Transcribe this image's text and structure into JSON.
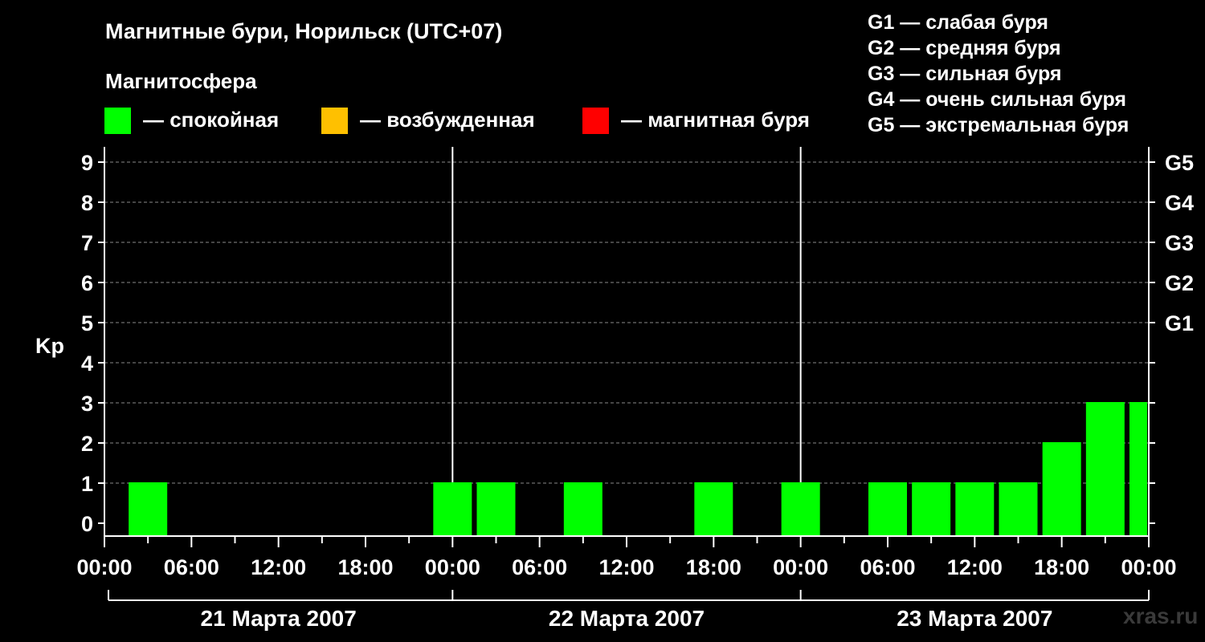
{
  "title": "Магнитные бури, Норильск (UTC+07)",
  "legend": {
    "title": "Магнитосфера",
    "items": [
      {
        "label": "— спокойная",
        "color": "#00ff00"
      },
      {
        "label": "— возбужденная",
        "color": "#ffc000"
      },
      {
        "label": "— магнитная буря",
        "color": "#ff0000"
      }
    ]
  },
  "g_scale_legend": [
    "G1 — слабая буря",
    "G2 — средняя буря",
    "G3 — сильная буря",
    "G4 — очень сильная буря",
    "G5 — экстремальная буря"
  ],
  "watermark": "xras.ru",
  "chart_data": {
    "type": "bar",
    "ylabel": "Kp",
    "ylim": [
      0,
      9
    ],
    "yticks": [
      0,
      1,
      2,
      3,
      4,
      5,
      6,
      7,
      8,
      9
    ],
    "right_axis_labels": [
      {
        "kp": 5,
        "label": "G1"
      },
      {
        "kp": 6,
        "label": "G2"
      },
      {
        "kp": 7,
        "label": "G3"
      },
      {
        "kp": 8,
        "label": "G4"
      },
      {
        "kp": 9,
        "label": "G5"
      }
    ],
    "xtick_labels": [
      "00:00",
      "06:00",
      "12:00",
      "18:00",
      "00:00",
      "06:00",
      "12:00",
      "18:00",
      "00:00",
      "06:00",
      "12:00",
      "18:00",
      "00:00"
    ],
    "day_labels": [
      "21 Марта 2007",
      "22 Марта 2007",
      "23 Марта 2007"
    ],
    "interval_hours": 3,
    "x_range_hours": [
      0,
      72
    ],
    "grid": "dashed horizontal at integer Kp",
    "series": [
      {
        "values": [
          1,
          1,
          0,
          0,
          0,
          0,
          0,
          0,
          1,
          1,
          0,
          1,
          0,
          0,
          1,
          0,
          1,
          0,
          1,
          1,
          1,
          1,
          2,
          3,
          3
        ],
        "color": "#00ff00"
      }
    ]
  }
}
